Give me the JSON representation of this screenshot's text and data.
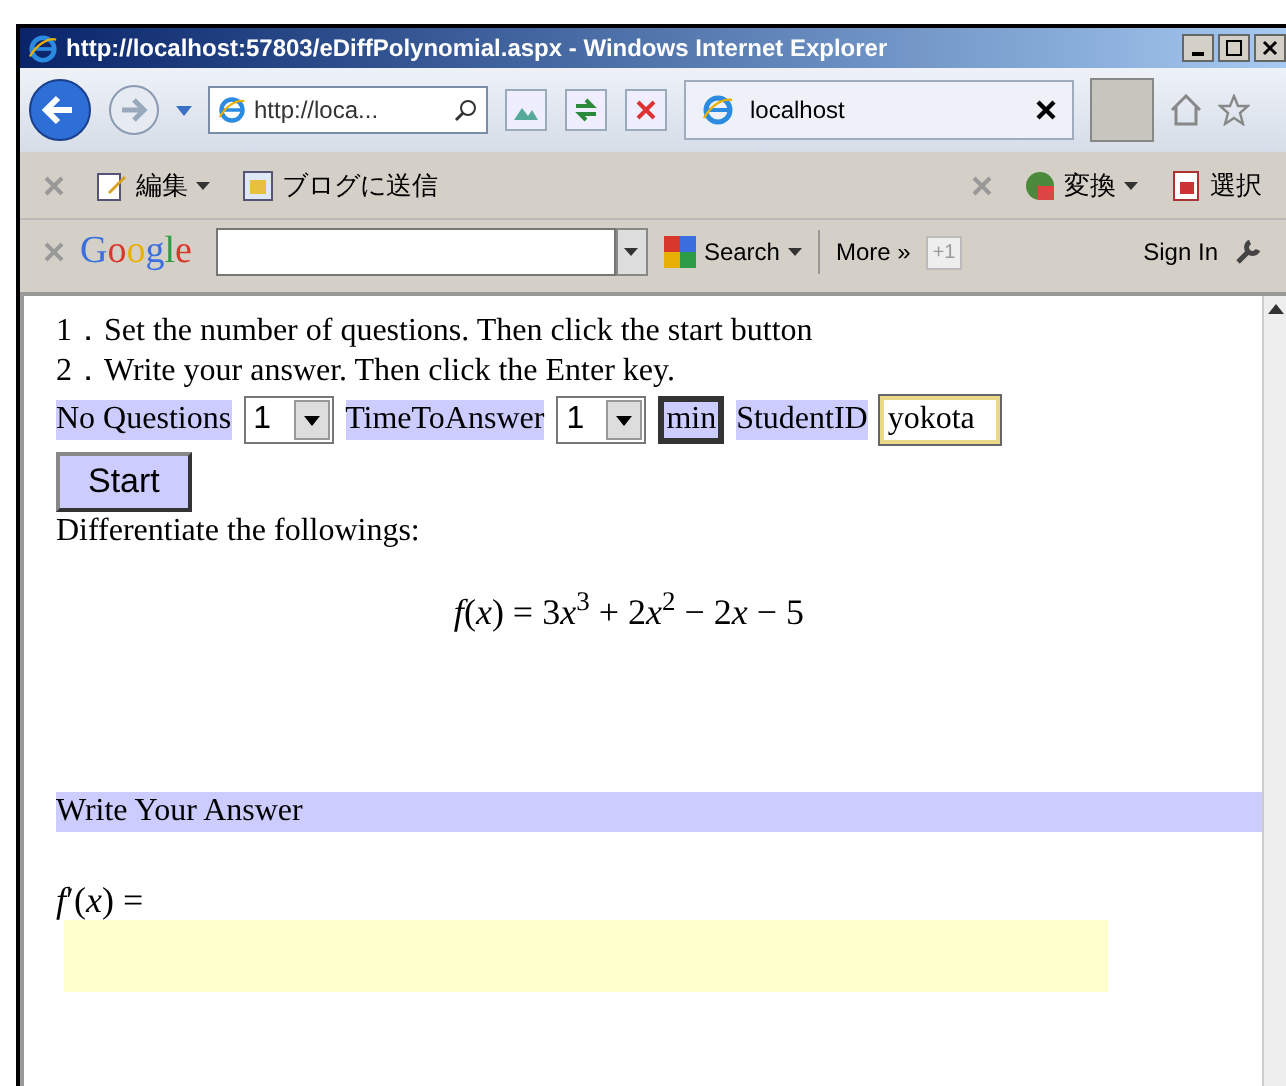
{
  "window": {
    "title": "http://localhost:57803/eDiffPolynomial.aspx - Windows Internet Explorer"
  },
  "nav": {
    "address": "http://loca...",
    "tab": "localhost"
  },
  "toolbar": {
    "left": [
      {
        "label": "編集",
        "dropdown": true
      },
      {
        "label": "ブログに送信",
        "dropdown": false
      }
    ],
    "right": [
      {
        "label": "変換",
        "dropdown": true
      },
      {
        "label": "選択",
        "dropdown": false
      }
    ]
  },
  "google_bar": {
    "logo": "Google",
    "search": "Search",
    "more": "More »",
    "plus": "+1",
    "sign_in": "Sign In"
  },
  "page": {
    "instructions": [
      "1．Set the number of questions. Then click the start button",
      "2．Write your answer. Then click the Enter key."
    ],
    "questions_label": "No Questions",
    "questions_value": "1",
    "time_label": "TimeToAnswer",
    "time_value": "1",
    "unit": "min",
    "student_label": "StudentID",
    "student_value": "yokota",
    "start": "Start",
    "prompt": "Differentiate the followings:",
    "formula": [
      {
        "kind": "var",
        "text": "f"
      },
      {
        "kind": "text",
        "text": "("
      },
      {
        "kind": "var",
        "text": "x"
      },
      {
        "kind": "text",
        "text": ") = 3"
      },
      {
        "kind": "var",
        "text": "x"
      },
      {
        "kind": "sup",
        "text": "3"
      },
      {
        "kind": "text",
        "text": " + 2"
      },
      {
        "kind": "var",
        "text": "x"
      },
      {
        "kind": "sup",
        "text": "2"
      },
      {
        "kind": "text",
        "text": " − 2"
      },
      {
        "kind": "var",
        "text": "x"
      },
      {
        "kind": "text",
        "text": " − 5"
      }
    ],
    "answer_header": "Write Your Answer",
    "answer_label": [
      {
        "kind": "var",
        "text": "f"
      },
      {
        "kind": "text",
        "text": "′("
      },
      {
        "kind": "var",
        "text": "x"
      },
      {
        "kind": "text",
        "text": ") ="
      }
    ]
  }
}
